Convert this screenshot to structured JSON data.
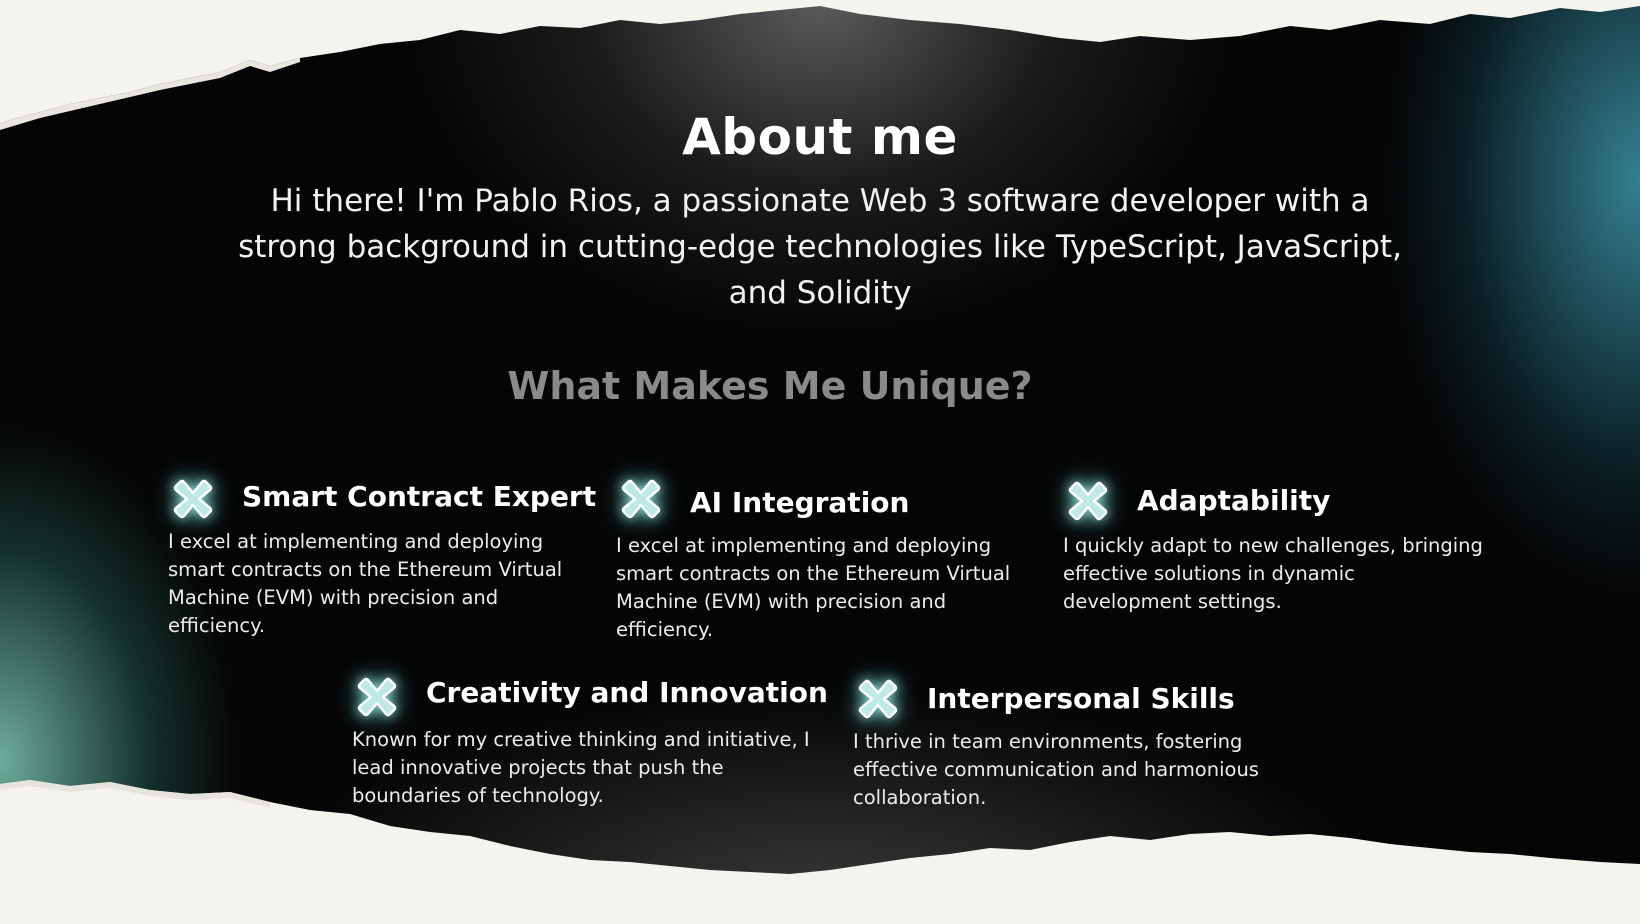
{
  "page": {
    "title": "About me",
    "intro": "Hi there! I'm  Pablo Rios, a passionate Web 3 software developer with a strong background in cutting-edge technologies like TypeScript, JavaScript, and Solidity",
    "subtitle": "What Makes Me Unique?"
  },
  "cards": [
    {
      "title": "Smart Contract Expert",
      "description": "I excel at implementing and deploying smart contracts on the Ethereum Virtual Machine (EVM) with precision and efficiency."
    },
    {
      "title": "AI Integration",
      "description": "I excel at implementing and deploying smart contracts on the Ethereum Virtual Machine (EVM) with precision and efficiency."
    },
    {
      "title": "Adaptability",
      "description": "I quickly adapt to new challenges, bringing effective solutions in dynamic development settings."
    },
    {
      "title": "Creativity and Innovation",
      "description": "Known for my creative thinking and initiative, I lead innovative projects that push the boundaries of technology."
    },
    {
      "title": "Interpersonal Skills",
      "description": "I thrive in team environments, fostering effective communication and harmonious collaboration."
    }
  ],
  "colors": {
    "paper": "#f4f3ee",
    "icon_fill": "#cfeeea",
    "icon_glow": "#7fd8d0",
    "subtitle": "#8a8a8a",
    "teal_accent": "#3c96aa"
  },
  "icons": {
    "card_icon": "x-cross-icon"
  }
}
